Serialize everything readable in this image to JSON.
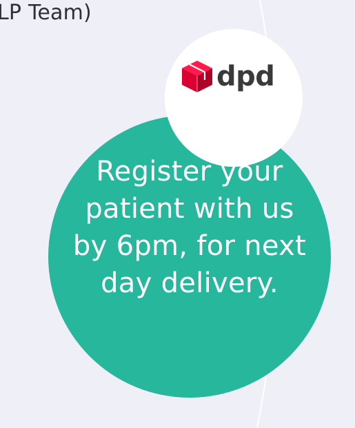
{
  "fragment": {
    "text": "LP Team)"
  },
  "logo": {
    "brand": "dpd",
    "icon": "dpd-parcel-cube-icon"
  },
  "message": {
    "lines": [
      "Register your",
      "patient with us",
      "by 6pm, for next",
      "day delivery."
    ]
  },
  "colors": {
    "background": "#eff0f7",
    "accent": "#27b79d",
    "brand_red": "#dc0032",
    "text_dark": "#2f2f36",
    "text_light": "#ffffff"
  }
}
